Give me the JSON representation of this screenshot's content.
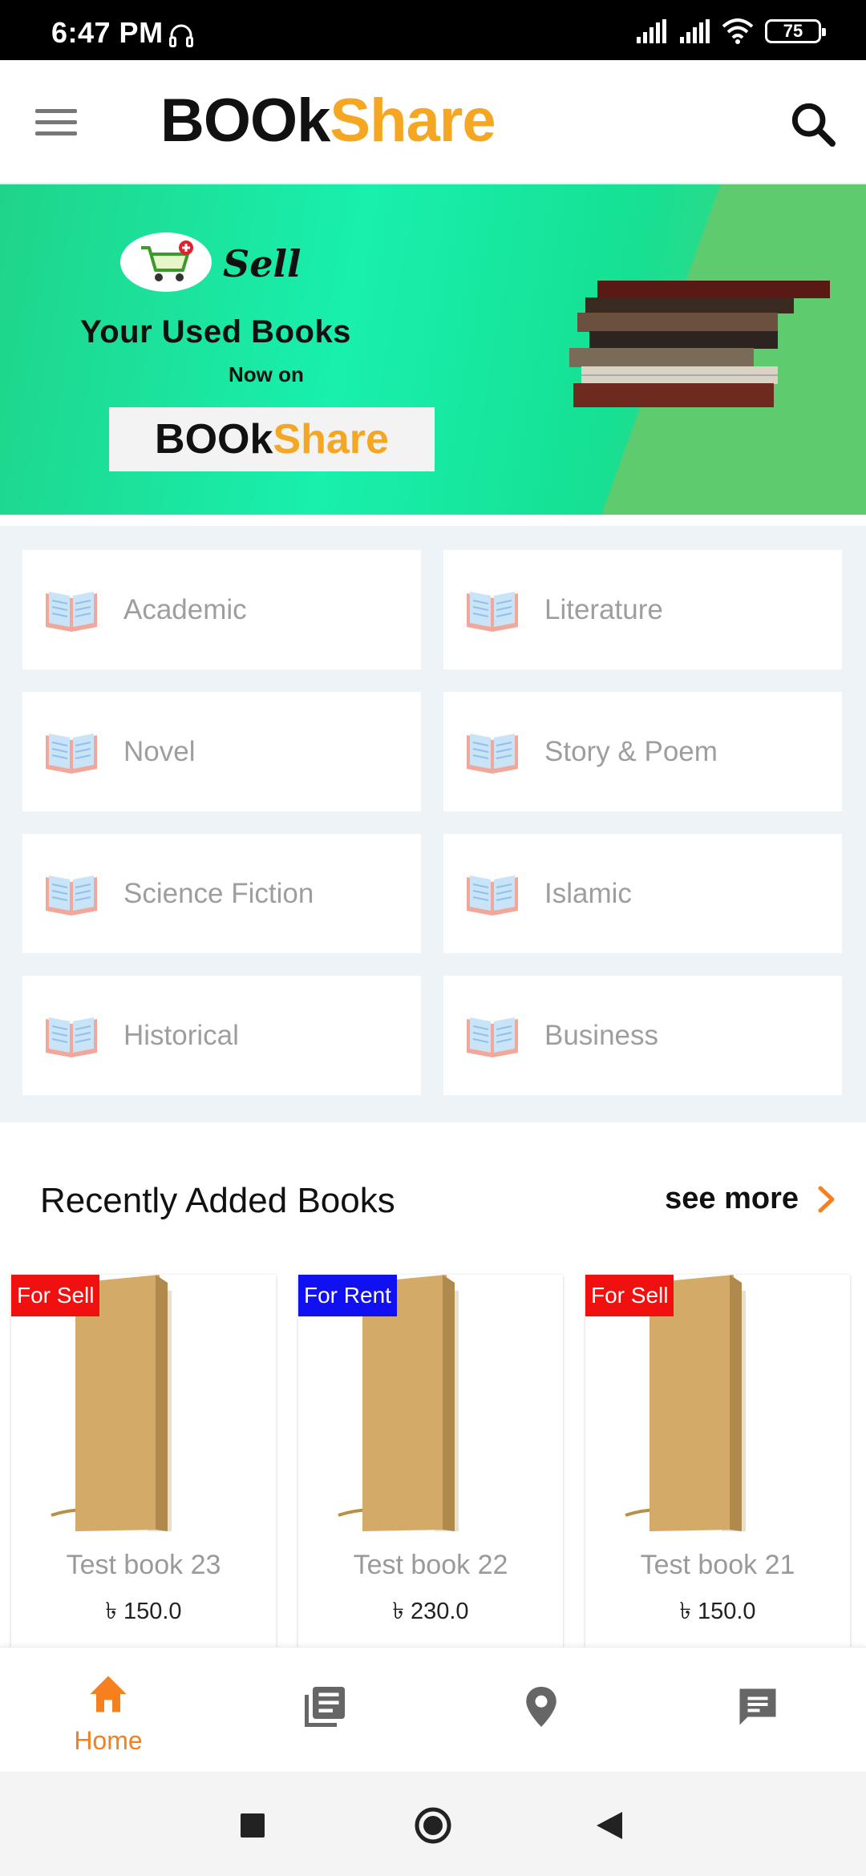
{
  "status_bar": {
    "time": "6:47 PM",
    "battery": "75"
  },
  "app_bar": {
    "logo_part1": "BOOk",
    "logo_part2": "Share"
  },
  "banner": {
    "sell": "Sell",
    "title": "Your Used Books",
    "subtitle": "Now on",
    "logo_part1": "BOOk",
    "logo_part2": "Share"
  },
  "categories": [
    {
      "label": "Academic"
    },
    {
      "label": "Literature"
    },
    {
      "label": "Novel"
    },
    {
      "label": "Story & Poem"
    },
    {
      "label": "Science Fiction"
    },
    {
      "label": "Islamic"
    },
    {
      "label": "Historical"
    },
    {
      "label": "Business"
    }
  ],
  "recent": {
    "title": "Recently Added Books",
    "see_more": "see more",
    "books": [
      {
        "badge": "For Sell",
        "title": "Test book 23",
        "price": "৳ 150.0"
      },
      {
        "badge": "For Rent",
        "title": "Test book 22",
        "price": "৳ 230.0"
      },
      {
        "badge": "For Sell",
        "title": "Test book 21",
        "price": "৳ 150.0"
      }
    ]
  },
  "bottom_nav": {
    "home_label": "Home"
  },
  "colors": {
    "accent": "#f7801e",
    "brand_orange": "#f5a623",
    "sell_badge": "#f01010",
    "rent_badge": "#1010f0"
  },
  "icons": {
    "menu": "hamburger-icon",
    "search": "search-icon",
    "category": "open-book-icon",
    "see_more": "chevron-right-icon",
    "home": "home-icon",
    "library": "library-books-icon",
    "location": "map-pin-icon",
    "chat": "chat-icon"
  }
}
